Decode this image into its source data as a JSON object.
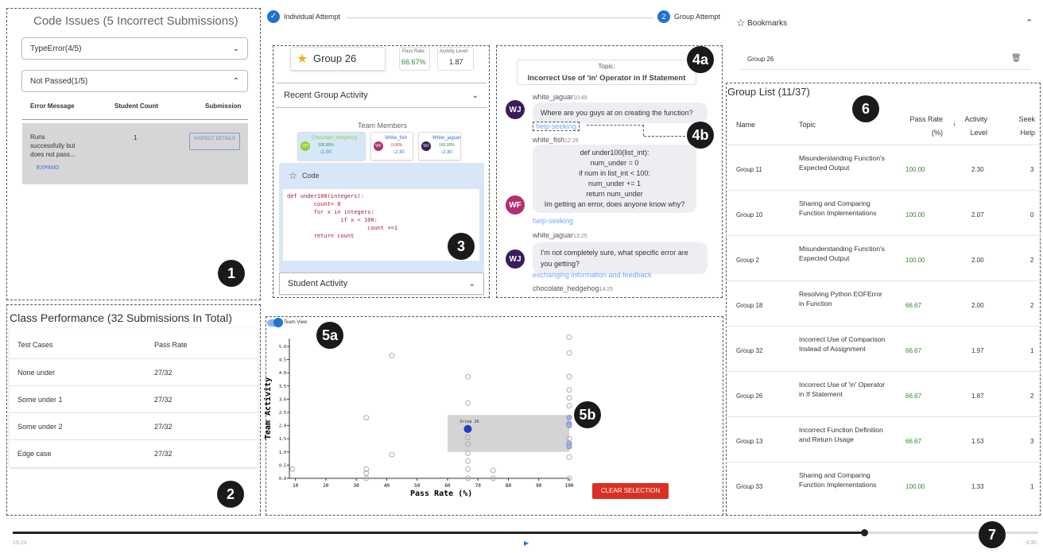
{
  "markers": [
    "1",
    "2",
    "3",
    "4a",
    "4b",
    "5a",
    "5b",
    "6",
    "7"
  ],
  "code_issues": {
    "title": "Code Issues (5 Incorrect Submissions)",
    "dropdown1": "TypeError(4/5)",
    "dropdown2": "Not Passed(1/5)",
    "headers": [
      "Error Message",
      "Student Count",
      "Submission"
    ],
    "row": {
      "message": "Runs successfully but does not pass...",
      "count": "1",
      "button": "INSPECT DETAILS",
      "expand": "EXPAND"
    }
  },
  "class_performance": {
    "title": "Class Performance (32 Submissions In Total)",
    "headers": [
      "Test Cases",
      "Pass Rate"
    ],
    "rows": [
      {
        "case": "None under",
        "rate": "27/32"
      },
      {
        "case": "Some under 1",
        "rate": "27/32"
      },
      {
        "case": "Some under 2",
        "rate": "27/32"
      },
      {
        "case": "Edge case",
        "rate": "27/32"
      }
    ]
  },
  "stepper": {
    "step1": "Individual Attempt",
    "step2_num": "2",
    "step2": "Group Attempt"
  },
  "group_card": {
    "name": "Group 26",
    "pass_rate_label": "Pass Rate:",
    "pass_rate": "66.67%",
    "activity_label": "Activity Level:",
    "activity": "1.87",
    "recent_activity": "Recent Group Activity",
    "team_members_title": "Team Members",
    "members": [
      {
        "initials": "CH",
        "name": "Chocolate_hedgehog",
        "rate": "100.00%",
        "act": "↕1.00",
        "color": "#9acd32"
      },
      {
        "initials": "WF",
        "name": "White_fish",
        "rate": "0.00%",
        "act": "↕2.30",
        "color": "#b03070"
      },
      {
        "initials": "WJ",
        "name": "White_jaguar",
        "rate": "100.00%",
        "act": "↕2.30",
        "color": "#3a1d5a"
      }
    ],
    "code_label": "Code",
    "code_lines": [
      "def under100(integers):",
      "        count= 0",
      "        for x in integers:",
      "                if x < 100:",
      "                        count +=1",
      "        return count"
    ],
    "student_activity": "Student Activity"
  },
  "chat": {
    "topic_label": "Topic:",
    "topic": "Incorrect Use of 'in' Operator in If Statement",
    "messages": [
      {
        "user": "white_jaguar",
        "time": "10:49",
        "text": "Where are you guys at on creating the function?",
        "tag": "help-seeking"
      },
      {
        "user": "white_fish",
        "time": "12:29",
        "text": "def under100(list_int):\n    num_under = 0\n    if num in list_int < 100:\n        num_under += 1\n    return num_under\nIm getting an error, does anyone know why?",
        "tag": "help-seeking"
      },
      {
        "user": "white_jaguar",
        "time": "13:25",
        "text": "I'm not completely sure, what specific error are you getting?",
        "tag": "exchanging information and feedback"
      },
      {
        "user": "chocolate_hedgehog",
        "time": "14:25"
      }
    ],
    "avatars": {
      "wj": "WJ",
      "wf": "WF"
    }
  },
  "bookmarks": {
    "title": "Bookmarks",
    "items": [
      "Group 26"
    ]
  },
  "group_list": {
    "title": "Group List (11/37)",
    "headers": {
      "name": "Name",
      "topic": "Topic",
      "pass": "Pass Rate (%)",
      "activity": "Activity Level",
      "seek": "Seek Help"
    },
    "rows": [
      {
        "name": "Group 11",
        "topic": "Misunderstanding Function's Expected Output",
        "pass": "100.00",
        "activity": "2.30",
        "seek": "3"
      },
      {
        "name": "Group 10",
        "topic": "Sharing and Comparing Function Implementations",
        "pass": "100.00",
        "activity": "2.07",
        "seek": "0"
      },
      {
        "name": "Group 2",
        "topic": "Misunderstanding Function's Expected Output",
        "pass": "100.00",
        "activity": "2.00",
        "seek": "2"
      },
      {
        "name": "Group 18",
        "topic": "Resolving Python EOFError in Function",
        "pass": "66.67",
        "activity": "2.00",
        "seek": "2"
      },
      {
        "name": "Group 32",
        "topic": "Incorrect Use of Comparison Instead of Assignment",
        "pass": "66.67",
        "activity": "1.97",
        "seek": "1"
      },
      {
        "name": "Group 26",
        "topic": "Incorrect Use of 'in' Operator in If Statement",
        "pass": "66.67",
        "activity": "1.87",
        "seek": "2"
      },
      {
        "name": "Group 13",
        "topic": "Incorrect Function Definition and Return Usage",
        "pass": "66.67",
        "activity": "1.53",
        "seek": "3"
      },
      {
        "name": "Group 33",
        "topic": "Sharing and Comparing Function Implementations",
        "pass": "100.00",
        "activity": "1.33",
        "seek": "1"
      }
    ]
  },
  "scatter": {
    "toggle_label": "Team View",
    "clear_button": "CLEAR SELECTION"
  },
  "chart_data": {
    "type": "scatter",
    "xlabel": "Pass Rate (%)",
    "ylabel": "Team Activity",
    "xlim": [
      8,
      100
    ],
    "ylim": [
      0,
      5.3
    ],
    "xticks": [
      10,
      20,
      30,
      40,
      50,
      60,
      70,
      80,
      90,
      100
    ],
    "yticks": [
      0.0,
      0.5,
      1.0,
      1.5,
      2.0,
      2.5,
      3.0,
      3.5,
      4.0,
      4.5,
      5.0
    ],
    "highlight": {
      "label": "Group 26",
      "x": 66.67,
      "y": 1.87,
      "color": "#1f3fbf"
    },
    "selection_box": {
      "x": [
        60,
        100
      ],
      "y": [
        1.0,
        2.4
      ]
    },
    "points": [
      [
        9,
        0.35
      ],
      [
        33.3,
        2.3
      ],
      [
        33.3,
        0.35
      ],
      [
        33.3,
        0.2
      ],
      [
        33.3,
        0.0
      ],
      [
        41.7,
        4.65
      ],
      [
        41.7,
        0.9
      ],
      [
        66.67,
        3.85
      ],
      [
        66.67,
        2.85
      ],
      [
        66.67,
        1.55
      ],
      [
        66.67,
        1.3
      ],
      [
        66.67,
        0.95
      ],
      [
        66.67,
        0.65
      ],
      [
        66.67,
        0.35
      ],
      [
        66.67,
        0.0
      ],
      [
        75,
        0.0
      ],
      [
        75,
        0.3
      ],
      [
        100,
        5.35
      ],
      [
        100,
        4.75
      ],
      [
        100,
        3.85
      ],
      [
        100,
        3.35
      ],
      [
        100,
        3.05
      ],
      [
        100,
        2.75
      ],
      [
        100,
        2.3
      ],
      [
        100,
        2.07
      ],
      [
        100,
        2.0
      ],
      [
        100,
        1.5
      ],
      [
        100,
        1.33
      ],
      [
        100,
        1.2
      ],
      [
        100,
        0.8
      ],
      [
        100,
        0.0
      ]
    ],
    "highlight_points": [
      [
        100,
        2.3
      ],
      [
        100,
        2.07
      ],
      [
        100,
        2.0
      ],
      [
        100,
        1.33
      ],
      [
        100,
        1.2
      ]
    ]
  },
  "video": {
    "current": "19:24",
    "remaining": "-3:30",
    "progress": 0.83
  }
}
